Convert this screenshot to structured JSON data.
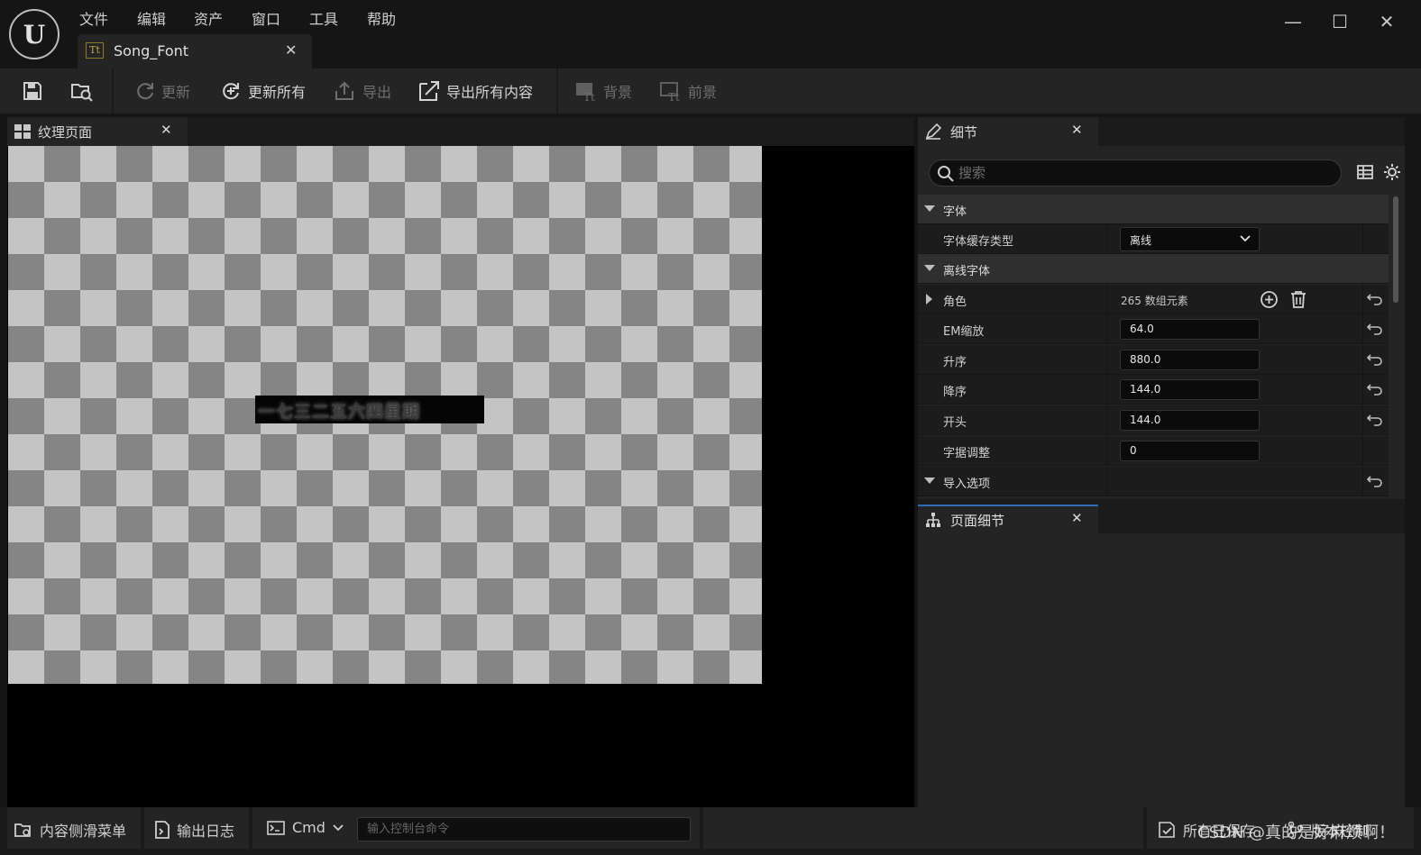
{
  "menu": [
    "文件",
    "编辑",
    "资产",
    "窗口",
    "工具",
    "帮助"
  ],
  "document_tab": {
    "label": "Song_Font",
    "icon": "font-asset-icon",
    "icon_text": "Tt"
  },
  "window_controls": {
    "minimize": "—",
    "maximize": "☐",
    "close": "✕"
  },
  "toolbar": {
    "save": "save-icon",
    "browse": "browse-icon",
    "update": "更新",
    "update_all": "更新所有",
    "export": "导出",
    "export_all": "导出所有内容",
    "background": "背景",
    "foreground": "前景"
  },
  "texture_panel": {
    "tab_label": "纹理页面",
    "glyph_text": "一七三二五六四星期"
  },
  "details": {
    "tab_label": "细节",
    "search_placeholder": "搜索",
    "categories": {
      "font": "字体",
      "offline_font": "离线字体",
      "import_options": "导入选项"
    },
    "rows": {
      "cache_type_label": "字体缓存类型",
      "cache_type_value": "离线",
      "characters_label": "角色",
      "characters_value": "265 数组元素",
      "em_scale_label": "EM缩放",
      "em_scale_value": "64.0",
      "ascent_label": "升序",
      "ascent_value": "880.0",
      "descent_label": "降序",
      "descent_value": "144.0",
      "leading_label": "开头",
      "leading_value": "144.0",
      "kerning_label": "字据调整",
      "kerning_value": "0"
    }
  },
  "page_details": {
    "tab_label": "页面细节"
  },
  "statusbar": {
    "content_drawer": "内容侧滑菜单",
    "output_log": "输出日志",
    "cmd": "Cmd",
    "cmd_placeholder": "输入控制台命令",
    "all_saved": "所有已保存",
    "source_control": "版本控制",
    "watermark": "CSDN @真的是好麻烦啊！"
  },
  "colors": {
    "accent": "#2e6bb8",
    "panel": "#242424",
    "background": "#151515"
  }
}
